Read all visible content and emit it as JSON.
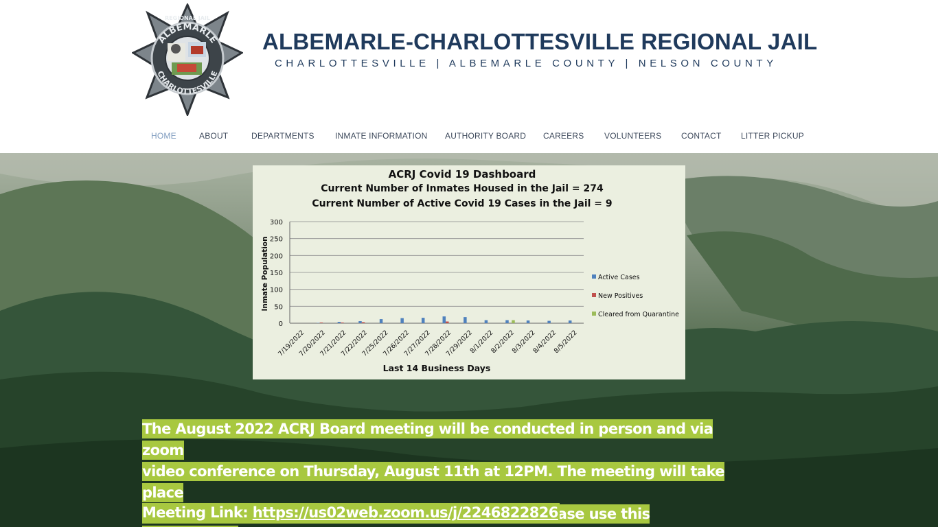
{
  "header": {
    "title": "ALBEMARLE-CHARLOTTESVILLE REGIONAL JAIL",
    "subtitle": "CHARLOTTESVILLE | ALBEMARLE COUNTY | NELSON COUNTY",
    "badge": {
      "top_text": "REGIONAL JAIL",
      "upper_text": "ALBEMARLE",
      "lower_text": "CHARLOTTESVILLE"
    }
  },
  "nav": {
    "items": [
      {
        "label": "HOME",
        "active": true
      },
      {
        "label": "ABOUT"
      },
      {
        "label": "DEPARTMENTS"
      },
      {
        "label": "INMATE INFORMATION"
      },
      {
        "label": "AUTHORITY BOARD"
      },
      {
        "label": "CAREERS"
      },
      {
        "label": "VOLUNTEERS"
      },
      {
        "label": "CONTACT"
      },
      {
        "label": "LITTER PICKUP"
      }
    ]
  },
  "dashboard": {
    "title": "ACRJ Covid 19 Dashboard",
    "line2": "Current Number of Inmates Housed in the Jail = 274",
    "line3": "Current Number of Active Covid 19 Cases in the Jail = 9"
  },
  "chart_data": {
    "type": "bar",
    "title": "ACRJ Covid 19 Dashboard",
    "xlabel": "Last 14 Business Days",
    "ylabel": "Inmate Population",
    "ylim": [
      0,
      300
    ],
    "yticks": [
      0,
      50,
      100,
      150,
      200,
      250,
      300
    ],
    "grid": true,
    "legend_position": "right",
    "categories": [
      "7/19/2022",
      "7/20/2022",
      "7/21/2022",
      "7/22/2022",
      "7/25/2022",
      "7/26/2022",
      "7/27/2022",
      "7/28/2022",
      "7/29/2022",
      "8/1/2022",
      "8/2/2022",
      "8/3/2022",
      "8/4/2022",
      "8/5/2022"
    ],
    "series": [
      {
        "name": "Active Cases",
        "color": "#4f81bd",
        "values": [
          0,
          1,
          4,
          6,
          12,
          15,
          16,
          20,
          18,
          9,
          9,
          8,
          7,
          8
        ]
      },
      {
        "name": "New Positives",
        "color": "#c0504d",
        "values": [
          0,
          2,
          2,
          3,
          0,
          0,
          0,
          5,
          0,
          0,
          0,
          0,
          0,
          0
        ]
      },
      {
        "name": "Cleared from Quarantine",
        "color": "#9bbb59",
        "values": [
          0,
          0,
          0,
          0,
          0,
          0,
          0,
          0,
          0,
          0,
          9,
          0,
          0,
          0
        ]
      }
    ]
  },
  "announcement": {
    "lines": [
      "The August 2022 ACRJ Board meeting will be conducted in person and via zoom",
      "video conference on Thursday, August 11th at 12PM. The meeting will take place",
      "in the muster room. To join the meeting via zoom, please use this information:"
    ],
    "link_label": "Meeting Link:",
    "link_url": "https://us02web.zoom.us/j/2246822826"
  },
  "colors": {
    "title": "#1f3a5c",
    "nav_active": "#7f9cbf",
    "highlight": "#a8c840"
  }
}
